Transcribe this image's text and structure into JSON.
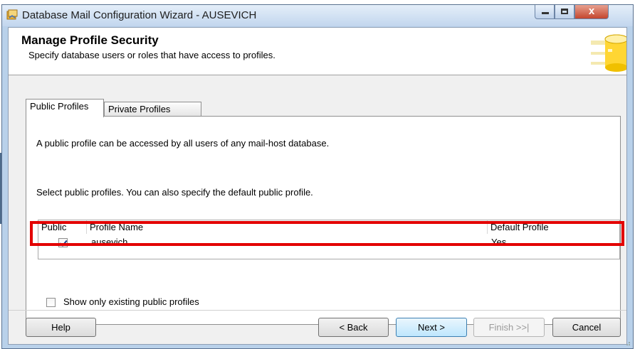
{
  "window": {
    "title": "Database Mail Configuration Wizard - AUSEVICH",
    "close_glyph": "x"
  },
  "header": {
    "title": "Manage Profile Security",
    "subtitle": "Specify database users or roles that have access to profiles."
  },
  "tabs": [
    {
      "label": "Public Profiles",
      "selected": true
    },
    {
      "label": "Private Profiles",
      "selected": false
    }
  ],
  "panel": {
    "description": "A public profile can be accessed by all users of any mail-host database.",
    "instruction": "Select public profiles. You can also specify the default public profile."
  },
  "grid": {
    "columns": [
      "Public",
      "Profile Name",
      "Default Profile"
    ],
    "rows": [
      {
        "public": true,
        "profile_name": "ausevich",
        "default_profile": "Yes"
      }
    ]
  },
  "filter_checkbox": {
    "label": "Show only existing public profiles",
    "checked": false
  },
  "buttons": {
    "help": "Help",
    "back": "< Back",
    "next": "Next >",
    "finish": "Finish >>|",
    "cancel": "Cancel"
  },
  "colors": {
    "highlight": "#e30000",
    "title_bar": "#c2d6ee",
    "close_button": "#c4462e"
  }
}
